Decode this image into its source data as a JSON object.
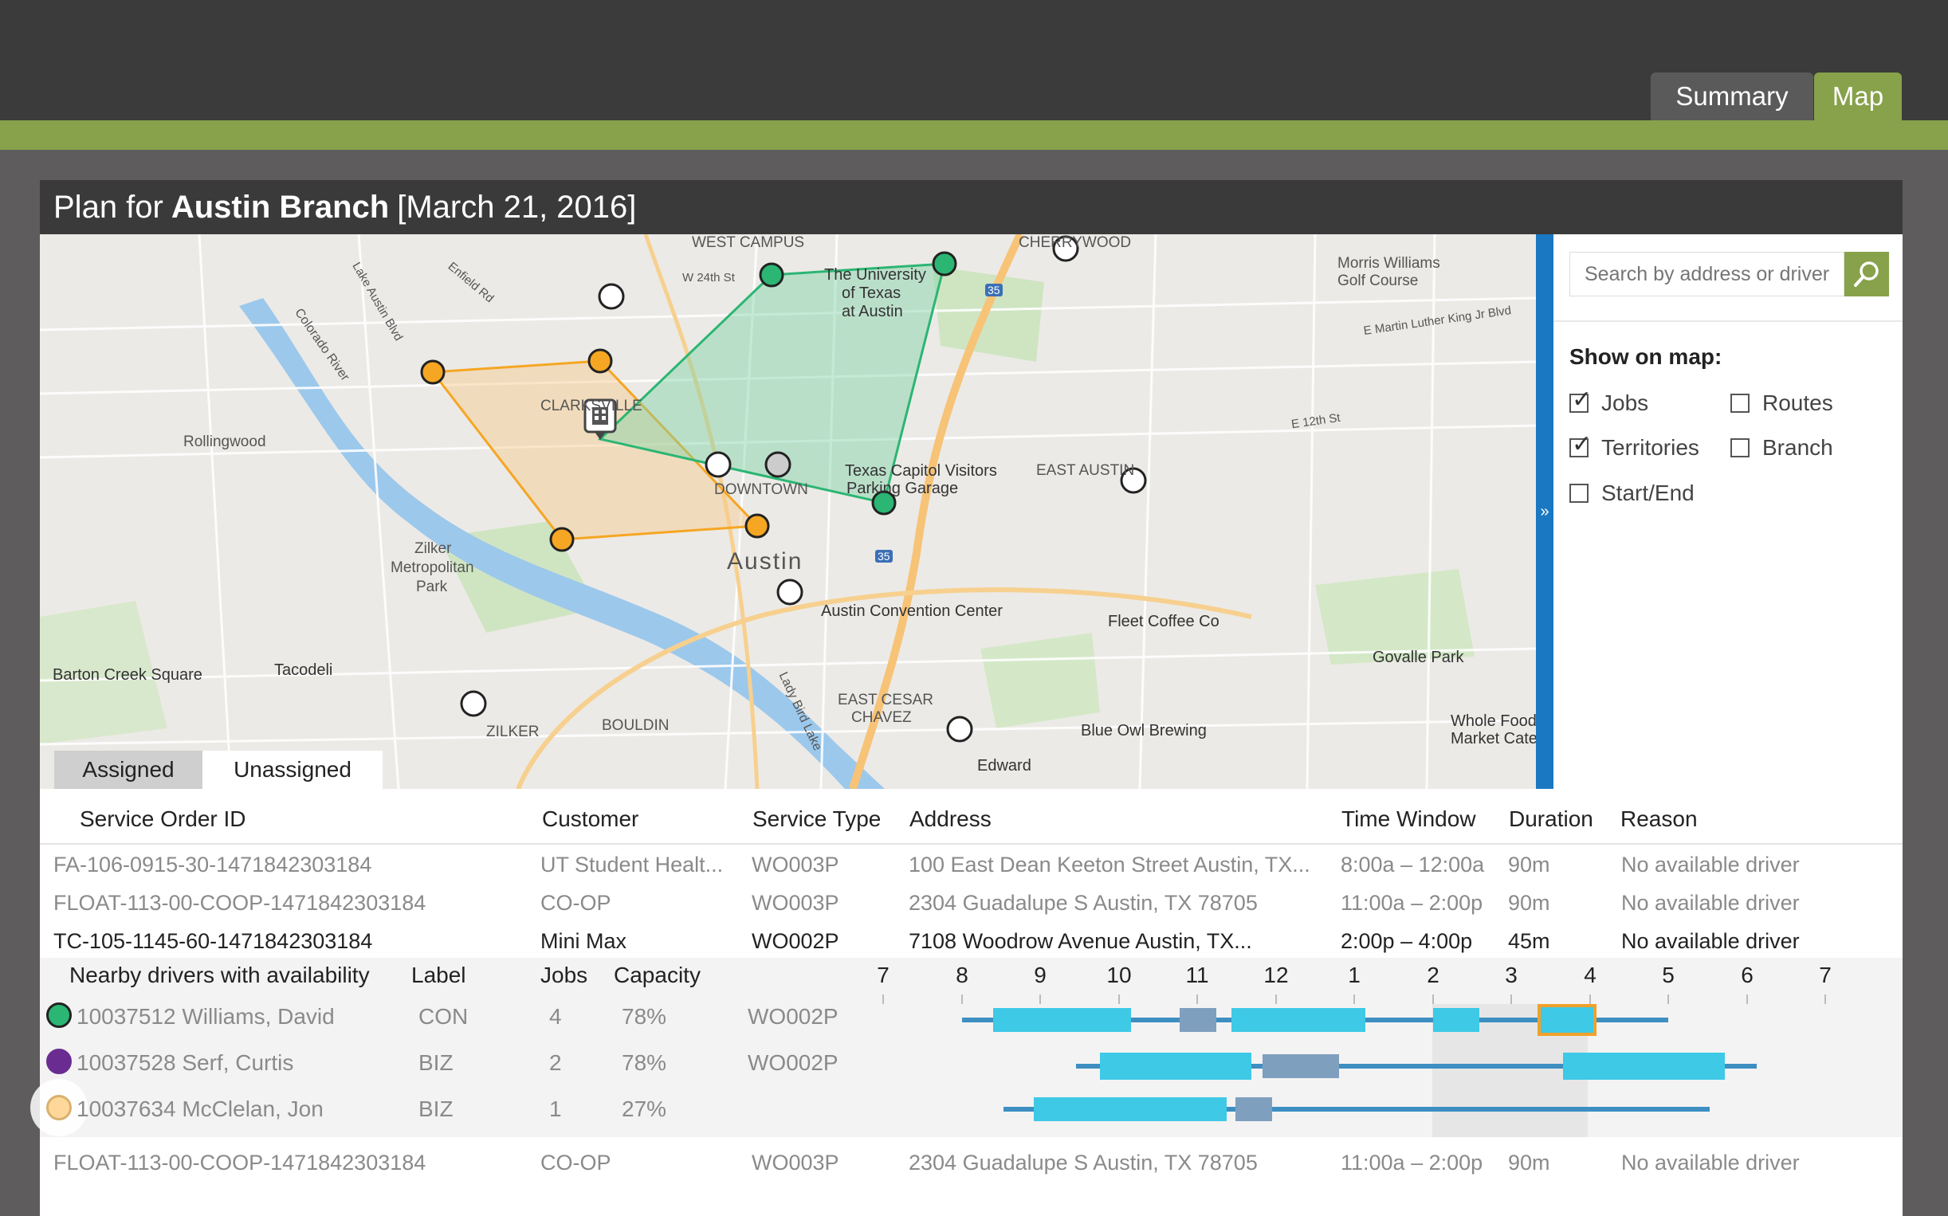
{
  "tabs": {
    "summary": "Summary",
    "map": "Map"
  },
  "header": {
    "prefix": "Plan for",
    "branch": "Austin Branch",
    "date": "[March 21, 2016]"
  },
  "map_labels": {
    "west_campus": "WEST CAMPUS",
    "cherrywood": "CHERRYWOOD",
    "morris": "Morris Williams",
    "golf": "Golf Course",
    "ut1": "The University",
    "ut2": "of Texas",
    "ut3": "at Austin",
    "rollingwood": "Rollingwood",
    "clarksville": "CLARKSVILLE",
    "downtown": "DOWNTOWN",
    "capitol1": "Texas Capitol Visitors",
    "capitol2": "Parking Garage",
    "east_austin": "EAST AUSTIN",
    "zilker1": "Zilker",
    "zilker2": "Metropolitan",
    "zilker3": "Park",
    "austin": "Austin",
    "convention": "Austin Convention Center",
    "fleet": "Fleet Coffee Co",
    "govalle": "Govalle Park",
    "barton": "Barton Creek Square",
    "tacodeli": "Tacodeli",
    "zilker_area": "ZILKER",
    "bouldin": "BOULDIN",
    "east_cesar1": "EAST CESAR",
    "east_cesar2": "CHAVEZ",
    "blue_owl": "Blue Owl Brewing",
    "whole1": "Whole Food",
    "whole2": "Market Cate",
    "edward": "Edward",
    "lady_bird": "Lady Bird Lake",
    "colorado": "Colorado River",
    "lake_austin": "Lake Austin Blvd",
    "mlk": "E Martin Luther King Jr Blvd",
    "e12": "E 12th St",
    "w24": "W 24th St",
    "enfield": "Enfield Rd",
    "i35a": "35",
    "i35b": "35"
  },
  "sidebar": {
    "search_placeholder": "Search by address or driver",
    "show_title": "Show on map:",
    "options": [
      {
        "label": "Jobs",
        "checked": true
      },
      {
        "label": "Routes",
        "checked": false
      },
      {
        "label": "Territories",
        "checked": true
      },
      {
        "label": "Branch",
        "checked": false
      },
      {
        "label": "Start/End",
        "checked": false
      }
    ],
    "collapse": "»"
  },
  "list_tabs": {
    "assigned": "Assigned",
    "unassigned": "Unassigned"
  },
  "table": {
    "headers": [
      "Service Order ID",
      "Customer",
      "Service Type",
      "Address",
      "Time Window",
      "Duration",
      "Reason"
    ],
    "rows": [
      [
        "FA-106-0915-30-1471842303184",
        "UT Student Healt...",
        "WO003P",
        "100 East Dean Keeton Street Austin, TX...",
        "8:00a – 12:00a",
        "90m",
        "No available driver"
      ],
      [
        "FLOAT-113-00-COOP-1471842303184",
        "CO-OP",
        "WO003P",
        "2304 Guadalupe S Austin, TX 78705",
        "11:00a – 2:00p",
        "90m",
        "No available driver"
      ],
      [
        "TC-105-1145-60-1471842303184",
        "Mini Max",
        "WO002P",
        "7108 Woodrow Avenue Austin, TX...",
        "2:00p – 4:00p",
        "45m",
        "No available driver"
      ],
      [
        "FLOAT-113-00-COOP-1471842303184",
        "CO-OP",
        "WO003P",
        "2304 Guadalupe S Austin, TX 78705",
        "11:00a – 2:00p",
        "90m",
        "No available driver"
      ]
    ]
  },
  "nearby": {
    "headers": [
      "Nearby drivers with availability",
      "Label",
      "Jobs",
      "Capacity"
    ],
    "hours": [
      "7",
      "8",
      "9",
      "10",
      "11",
      "12",
      "1",
      "2",
      "3",
      "4",
      "5",
      "6",
      "7"
    ],
    "drivers": [
      {
        "id_name": "10037512 Williams, David",
        "label": "CON",
        "jobs": "4",
        "capacity": "78%",
        "type": "WO002P",
        "color": "#2bb673"
      },
      {
        "id_name": "10037528 Serf, Curtis",
        "label": "BIZ",
        "jobs": "2",
        "capacity": "78%",
        "type": "WO002P",
        "color": "#6a2c91"
      },
      {
        "id_name": "10037634 McClelan, Jon",
        "label": "BIZ",
        "jobs": "1",
        "capacity": "27%",
        "type": "",
        "color": "#fdd89a"
      }
    ]
  },
  "colors": {
    "accent_green": "#87a24a",
    "header_dark": "#3a3a3a",
    "territory_green": "#2bb673",
    "territory_orange": "#f5a623",
    "timeline_blue": "#3ec9e6"
  }
}
